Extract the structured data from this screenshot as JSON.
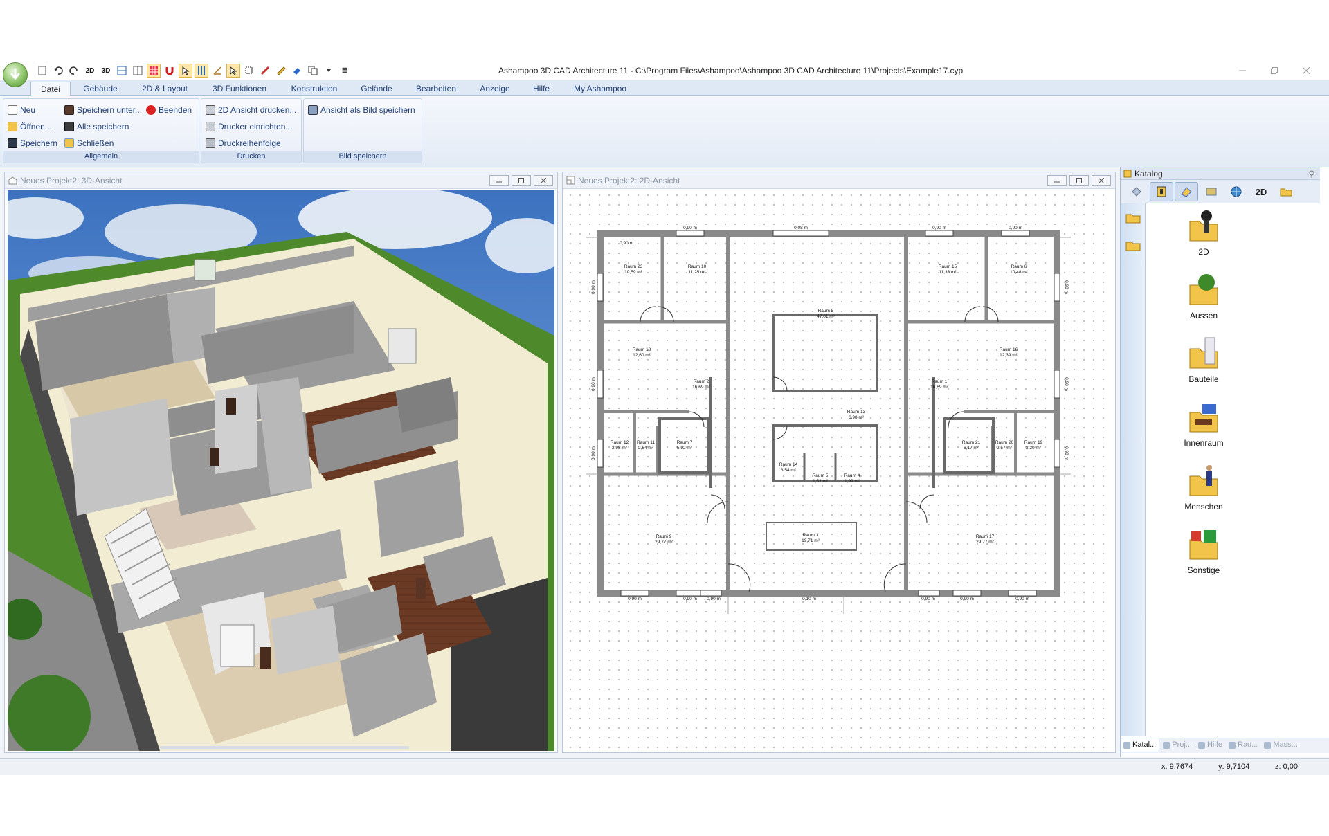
{
  "window": {
    "title": "Ashampoo 3D CAD Architecture 11 - C:\\Program Files\\Ashampoo\\Ashampoo 3D CAD Architecture 11\\Projects\\Example17.cyp"
  },
  "qat": {
    "btn_2d": "2D",
    "btn_3d": "3D",
    "overflow": "≣"
  },
  "ribbon": {
    "tabs": [
      "Datei",
      "Gebäude",
      "2D & Layout",
      "3D Funktionen",
      "Konstruktion",
      "Gelände",
      "Bearbeiten",
      "Anzeige",
      "Hilfe",
      "My Ashampoo"
    ],
    "groups": {
      "allgemein": {
        "label": "Allgemein",
        "neu": "Neu",
        "oeffnen": "Öffnen...",
        "speichern": "Speichern",
        "speichern_unter": "Speichern unter...",
        "alle_speichern": "Alle speichern",
        "schliessen": "Schließen",
        "beenden": "Beenden"
      },
      "drucken": {
        "label": "Drucken",
        "ansicht_drucken": "2D Ansicht drucken...",
        "drucker_einrichten": "Drucker einrichten...",
        "druckreihenfolge": "Druckreihenfolge"
      },
      "bild": {
        "label": "Bild speichern",
        "ansicht_als_bild": "Ansicht als Bild speichern"
      }
    }
  },
  "view3d": {
    "title": "Neues Projekt2: 3D-Ansicht"
  },
  "view2d": {
    "title": "Neues Projekt2: 2D-Ansicht",
    "rooms": [
      {
        "name": "Raum 23",
        "area": "10,59 m²"
      },
      {
        "name": "Raum 10",
        "area": "11,25 m²"
      },
      {
        "name": "Raum 15",
        "area": "11,36 m²"
      },
      {
        "name": "Raum 6",
        "area": "10,48 m²"
      },
      {
        "name": "Raum 8",
        "area": "47,01 m²"
      },
      {
        "name": "Raum 18",
        "area": "12,60 m²"
      },
      {
        "name": "Raum 16",
        "area": "12,39 m²"
      },
      {
        "name": "Raum 2",
        "area": "16,69 m²"
      },
      {
        "name": "Raum 1",
        "area": "16,69 m²"
      },
      {
        "name": "Raum 13",
        "area": "6,98 m²"
      },
      {
        "name": "Raum 12",
        "area": "2,98 m²"
      },
      {
        "name": "Raum 11",
        "area": "2,64 m²"
      },
      {
        "name": "Raum 7",
        "area": "5,92 m²"
      },
      {
        "name": "Raum 21",
        "area": "6,17 m²"
      },
      {
        "name": "Raum 20",
        "area": "2,57 m²"
      },
      {
        "name": "Raum 19",
        "area": "2,20 m²"
      },
      {
        "name": "Raum 14",
        "area": "3,54 m²"
      },
      {
        "name": "Raum 5",
        "area": "1,52 m²"
      },
      {
        "name": "Raum 4",
        "area": "1,99 m²"
      },
      {
        "name": "Raum 9",
        "area": "29,77 m²"
      },
      {
        "name": "Raum 17",
        "area": "29,77 m²"
      },
      {
        "name": "Raum 3",
        "area": "19,71 m²"
      }
    ],
    "dimensions": {
      "top_1": "0,90 m",
      "top_2": "0,08 m",
      "top_3": "0,90 m",
      "top_4": "0,90 m",
      "inner_top": "0,90 m",
      "left_1": "0,90 m",
      "left_2": "0,90 m",
      "left_3": "0,90 m",
      "right_1": "0,90 m",
      "right_2": "0,90 m",
      "right_3": "0,90 m",
      "bottom_1": "0,90 m",
      "bottom_2": "0,90 m",
      "bottom_3": "0,90 m",
      "bottom_mid": "0,10 m",
      "bottom_4": "0,90 m",
      "bottom_5": "0,90 m",
      "bottom_6": "0,90 m"
    }
  },
  "catalog": {
    "title": "Katalog",
    "toolbar_2d": "2D",
    "items": [
      "2D",
      "Aussen",
      "Bauteile",
      "Innenraum",
      "Menschen",
      "Sonstige"
    ],
    "tabs": [
      "Katal...",
      "Proj...",
      "Hilfe",
      "Rau...",
      "Mass..."
    ]
  },
  "status": {
    "x": "x: 9,7674",
    "y": "y: 9,7104",
    "z": "z: 0,00"
  },
  "colors": {
    "accent": "#1e3e74",
    "ribbon_bg": "#e3ebf6",
    "wall": "#8e8e8e",
    "floor_wood": "#6b3a24",
    "grass": "#4e8a2c",
    "sky": "#4c7fc4"
  }
}
